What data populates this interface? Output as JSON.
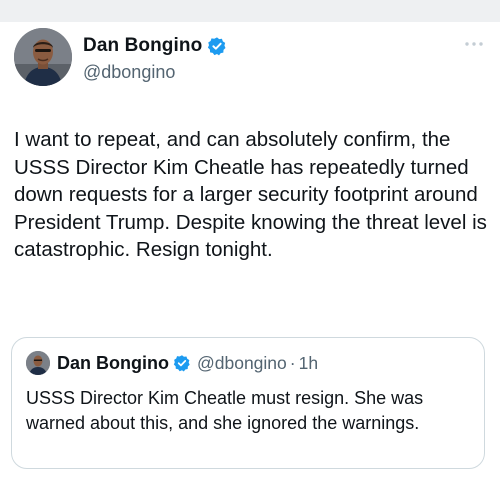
{
  "tweet": {
    "author": {
      "display_name": "Dan Bongino",
      "handle": "@dbongino",
      "verified": true
    },
    "more_icon": "more-horizontal-icon",
    "text": "I want to repeat, and can absolutely confirm, the USSS Director Kim Cheatle has repeatedly turned down requests for a larger security footprint around President Trump. Despite knowing the threat level is catastrophic. Resign tonight."
  },
  "quoted_tweet": {
    "author": {
      "display_name": "Dan Bongino",
      "handle": "@dbongino",
      "verified": true
    },
    "separator": "·",
    "time": "1h",
    "text": "USSS Director Kim Cheatle must resign. She was warned about this, and she ignored the warnings."
  },
  "colors": {
    "verified_badge": "#1d9bf0",
    "secondary_text": "#536471",
    "border": "#cfd9de",
    "top_strip": "#eef0f2"
  }
}
